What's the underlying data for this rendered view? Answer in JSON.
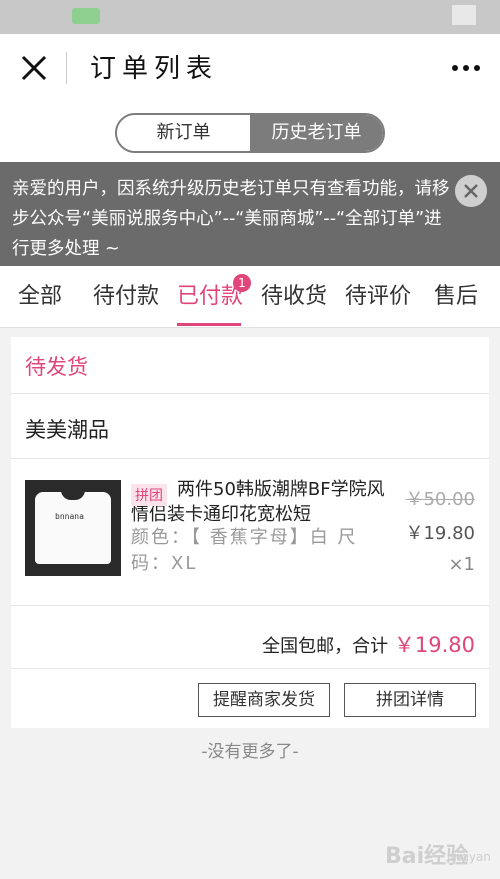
{
  "colors": {
    "accent": "#e0457b",
    "notice_bg": "#6b6b6b",
    "segment_bg": "#7c7c7c"
  },
  "navbar": {
    "title": "订单列表",
    "close_icon": "close-icon",
    "more_icon": "more-dots-icon"
  },
  "segment": {
    "new_label": "新订单",
    "history_label": "历史老订单",
    "active": "new"
  },
  "notice": {
    "text": "亲爱的用户，因系统升级历史老订单只有查看功能，请移步公众号“美丽说服务中心”--“美丽商城”--“全部订单”进行更多处理 ~",
    "close_icon": "close-circle-icon"
  },
  "tabs": [
    {
      "label": "全部"
    },
    {
      "label": "待付款"
    },
    {
      "label": "已付款",
      "active": true,
      "badge": "1"
    },
    {
      "label": "待收货"
    },
    {
      "label": "待评价"
    },
    {
      "label": "售后"
    }
  ],
  "order": {
    "status": "待发货",
    "shop_name": "美美潮品",
    "item": {
      "tag": "拼团",
      "title": "两件50韩版潮牌BF学院风情侣装卡通印花宽松短",
      "spec": "颜色：【 香蕉字母】白 尺码：XL",
      "original_price": "￥50.00",
      "price": "￥19.80",
      "quantity": "×1",
      "image_print": "bnnana"
    },
    "summary_label": "全国包邮，合计",
    "total": "￥19.80",
    "buttons": {
      "remind": "提醒商家发货",
      "group_detail": "拼团详情"
    }
  },
  "footer": {
    "no_more": "-没有更多了-"
  },
  "watermark": {
    "text": "Bai经验",
    "sub": "jingyan"
  }
}
